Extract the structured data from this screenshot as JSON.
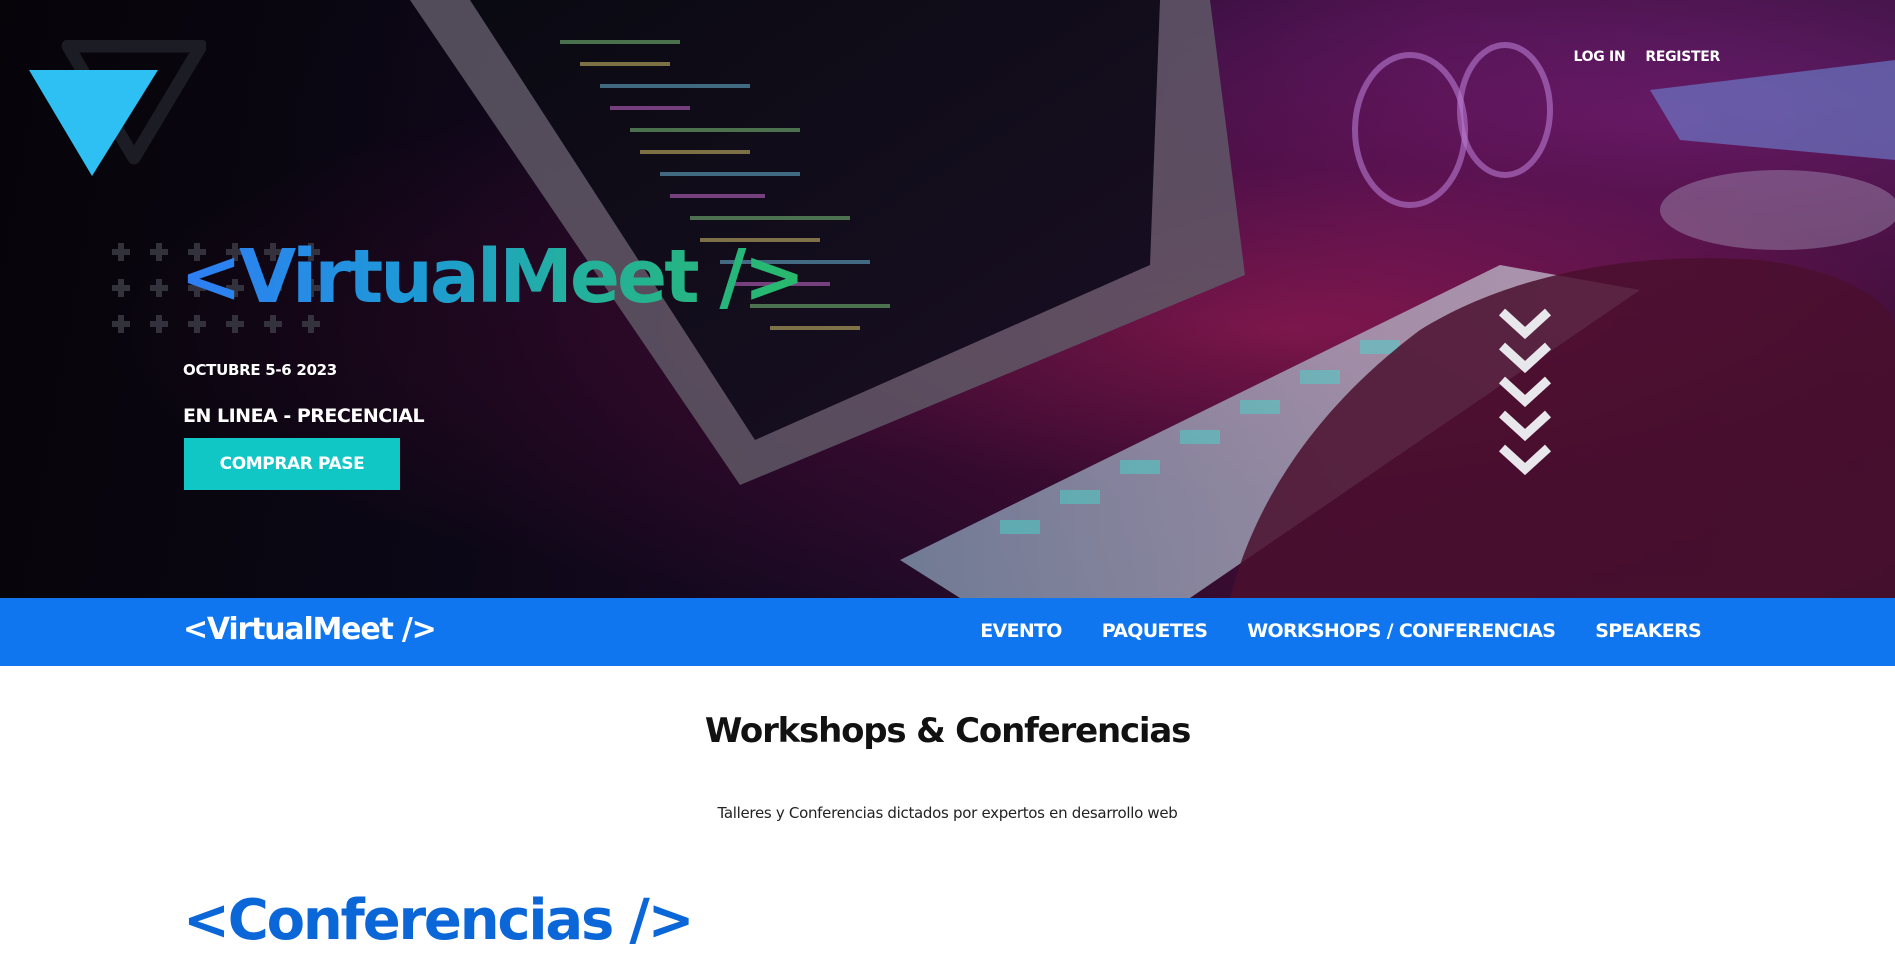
{
  "header": {
    "links": [
      {
        "label": "LOG IN"
      },
      {
        "label": "REGISTER"
      }
    ]
  },
  "hero": {
    "title": "<VirtualMeet />",
    "date": "OCTUBRE 5-6 2023",
    "mode": "EN LINEA - PRECENCIAL",
    "cta_label": "COMPRAR PASE"
  },
  "navbar": {
    "logo": "<VirtualMeet />",
    "items": [
      {
        "label": "EVENTO"
      },
      {
        "label": "PAQUETES"
      },
      {
        "label": "WORKSHOPS / CONFERENCIAS"
      },
      {
        "label": "SPEAKERS"
      }
    ]
  },
  "content": {
    "title": "Workshops & Conferencias",
    "subtitle": "Talleres y Conferencias dictados por expertos en desarrollo web",
    "conferencias_heading": "<Conferencias />"
  },
  "colors": {
    "brand_blue": "#0f76f0",
    "cta_teal": "#11c7c5",
    "heading_blue": "#0b66d8",
    "logo_blue": "#2ec0f3"
  },
  "icons": {
    "logo": "v-triangle-logo-icon",
    "scroll": "chevrons-down-icon",
    "decoration": "plus-grid-icon"
  }
}
